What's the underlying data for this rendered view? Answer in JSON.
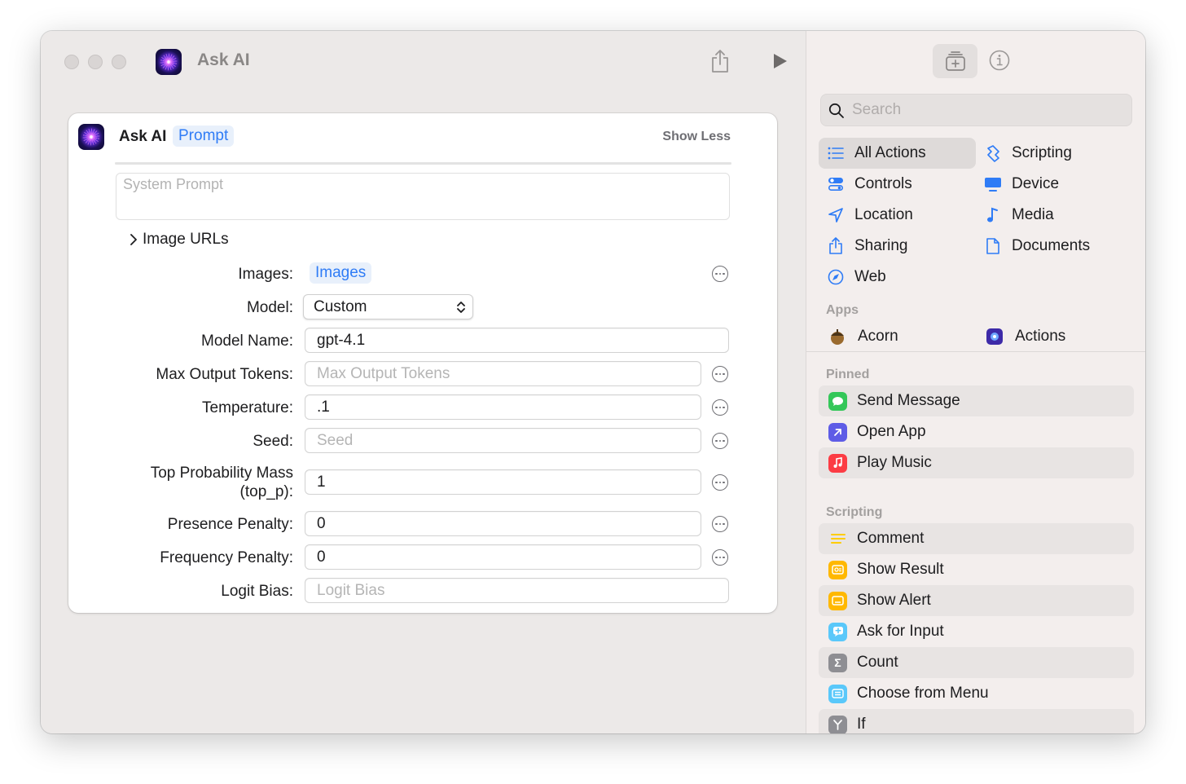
{
  "window": {
    "title": "Ask AI"
  },
  "card": {
    "title": "Ask AI",
    "token": "Prompt",
    "show_less": "Show Less",
    "system_prompt_placeholder": "System Prompt",
    "image_urls_label": "Image URLs",
    "fields": {
      "images": {
        "label": "Images:",
        "token": "Images"
      },
      "model": {
        "label": "Model:",
        "value": "Custom"
      },
      "model_name": {
        "label": "Model Name:",
        "value": "gpt-4.1"
      },
      "max_output_tokens": {
        "label": "Max Output Tokens:",
        "placeholder": "Max Output Tokens"
      },
      "temperature": {
        "label": "Temperature:",
        "value": ".1"
      },
      "seed": {
        "label": "Seed:",
        "placeholder": "Seed"
      },
      "top_p": {
        "label_line1": "Top Probability Mass",
        "label_line2": "(top_p):",
        "value": "1"
      },
      "presence_penalty": {
        "label": "Presence Penalty:",
        "value": "0"
      },
      "frequency_penalty": {
        "label": "Frequency Penalty:",
        "value": "0"
      },
      "logit_bias": {
        "label": "Logit Bias:",
        "placeholder": "Logit Bias"
      }
    }
  },
  "sidebar": {
    "search_placeholder": "Search",
    "categories": [
      {
        "label": "All Actions",
        "icon": "list-icon",
        "selected": true
      },
      {
        "label": "Scripting",
        "icon": "scripting-icon"
      },
      {
        "label": "Controls",
        "icon": "toggle-icon"
      },
      {
        "label": "Device",
        "icon": "monitor-icon"
      },
      {
        "label": "Location",
        "icon": "location-arrow-icon"
      },
      {
        "label": "Media",
        "icon": "music-note-icon"
      },
      {
        "label": "Sharing",
        "icon": "share-icon"
      },
      {
        "label": "Documents",
        "icon": "document-icon"
      },
      {
        "label": "Web",
        "icon": "compass-icon"
      }
    ],
    "apps_heading": "Apps",
    "apps": [
      {
        "label": "Acorn",
        "icon": "acorn-icon"
      },
      {
        "label": "Actions",
        "icon": "actions-app-icon"
      }
    ],
    "pinned_heading": "Pinned",
    "pinned": [
      {
        "label": "Send Message",
        "icon": "message-bubble-icon",
        "color": "#34c759"
      },
      {
        "label": "Open App",
        "icon": "arrow-up-right-icon",
        "color": "#5e5ce6"
      },
      {
        "label": "Play Music",
        "icon": "music-note-icon",
        "color": "#fc3c44"
      }
    ],
    "scripting_heading": "Scripting",
    "scripting": [
      {
        "label": "Comment",
        "icon": "lines-icon",
        "color": "#ffcc00"
      },
      {
        "label": "Show Result",
        "icon": "show-result-icon",
        "color": "#ffb800"
      },
      {
        "label": "Show Alert",
        "icon": "alert-window-icon",
        "color": "#ffb800"
      },
      {
        "label": "Ask for Input",
        "icon": "plus-bubble-icon",
        "color": "#5ac8fa"
      },
      {
        "label": "Count",
        "icon": "sigma-icon",
        "color": "#8e8e93"
      },
      {
        "label": "Choose from Menu",
        "icon": "menu-list-icon",
        "color": "#5ac8fa"
      },
      {
        "label": "If",
        "icon": "branch-icon",
        "color": "#8e8e93"
      }
    ]
  }
}
